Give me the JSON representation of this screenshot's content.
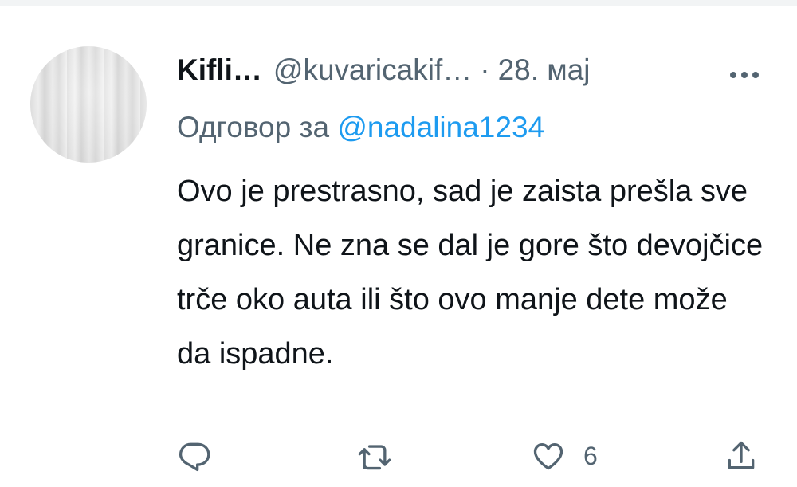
{
  "tweet": {
    "display_name": "Kifli…",
    "handle": "@kuvaricakif…",
    "separator": "·",
    "date": "28. мај",
    "reply_prefix": "Одговор за",
    "reply_mention": "@nadalina1234",
    "text": "Ovo je prestrasno, sad je zaista prešla sve granice. Ne zna se dal je gore što devojčice trče oko auta ili što ovo manje dete može da ispadne.",
    "actions": {
      "reply_icon": "reply-icon",
      "retweet_icon": "retweet-icon",
      "like_icon": "heart-icon",
      "like_count": "6",
      "share_icon": "share-icon"
    }
  },
  "colors": {
    "text_primary": "#0f1419",
    "text_secondary": "#536471",
    "accent": "#1d9bf0"
  }
}
